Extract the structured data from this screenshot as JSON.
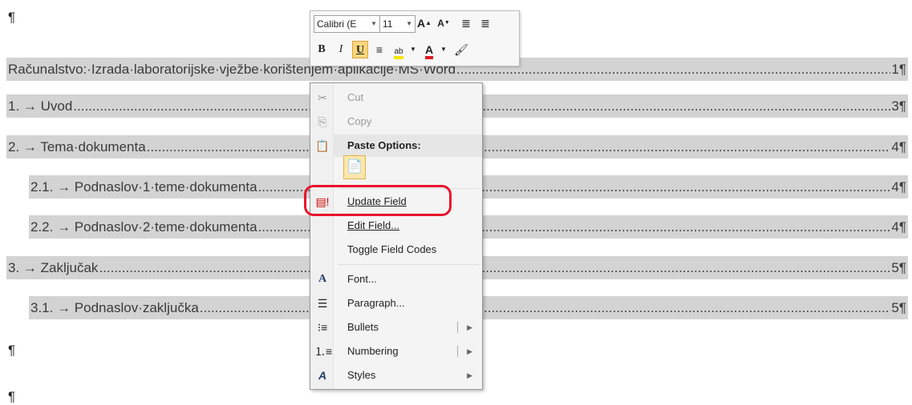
{
  "document": {
    "pilcrow": "¶",
    "toc": [
      {
        "text": "Računalstvo:·Izrada·laboratorijske·vježbe·korištenjem·aplikacije·MS·Word",
        "page": "1¶"
      },
      {
        "text": "1. → Uvod",
        "page": "3¶"
      },
      {
        "text": "2. → Tema·dokumenta",
        "page": "4¶"
      },
      {
        "text": "2.1. → Podnaslov·1·teme·dokumenta",
        "page": "4¶"
      },
      {
        "text": "2.2. → Podnaslov·2·teme·dokumenta",
        "page": "4¶"
      },
      {
        "text": "3. → Zaključak",
        "page": "5¶"
      },
      {
        "text": "3.1. → Podnaslov·zaključka",
        "page": "5¶"
      }
    ]
  },
  "mini_toolbar": {
    "font_name": "Calibri (E",
    "font_size": "11",
    "bold": "B",
    "italic": "I",
    "underline": "U"
  },
  "context_menu": {
    "cut": "Cut",
    "copy": "Copy",
    "paste_options": "Paste Options:",
    "update_field": "Update Field",
    "edit_field": "Edit Field...",
    "toggle_field_codes": "Toggle Field Codes",
    "font": "Font...",
    "paragraph": "Paragraph...",
    "bullets": "Bullets",
    "numbering": "Numbering",
    "styles": "Styles"
  },
  "colors": {
    "field_shading": "#d3d3d3",
    "highlight_ring": "#e8132b",
    "active_button": "#f9d77c"
  }
}
